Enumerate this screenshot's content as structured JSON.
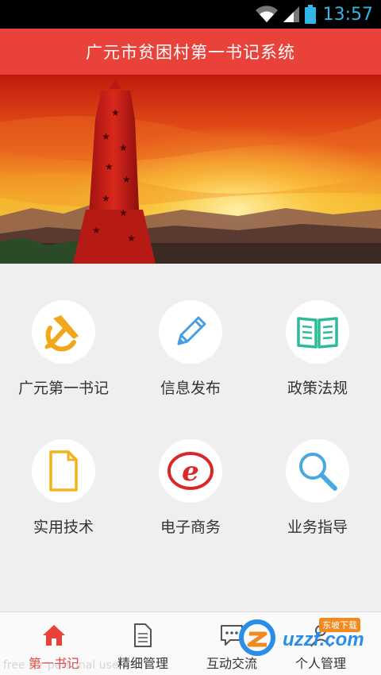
{
  "status_bar": {
    "time": "13:57",
    "time_color": "#33b5e5"
  },
  "header": {
    "title": "广元市贫困村第一书记系统",
    "background": "#e8423a"
  },
  "banner": {
    "image": "red-monument-sunset-photo"
  },
  "menu": {
    "items": [
      {
        "label": "广元第一书记",
        "icon": "party-emblem-icon"
      },
      {
        "label": "信息发布",
        "icon": "pencil-icon"
      },
      {
        "label": "政策法规",
        "icon": "open-book-icon"
      },
      {
        "label": "实用技术",
        "icon": "document-icon"
      },
      {
        "label": "电子商务",
        "icon": "e-letter-icon"
      },
      {
        "label": "业务指导",
        "icon": "magnifier-icon"
      }
    ]
  },
  "tabbar": {
    "tabs": [
      {
        "label": "第一书记",
        "icon": "home-icon",
        "active": true
      },
      {
        "label": "精细管理",
        "icon": "document-icon"
      },
      {
        "label": "互动交流",
        "icon": "chat-bubble-icon"
      },
      {
        "label": "个人管理",
        "icon": "person-icon"
      }
    ],
    "active_color": "#e8423a"
  },
  "watermark": {
    "text": "free for personal use",
    "logo_brand": "uzzf.com",
    "logo_tag": "东坡下载"
  }
}
